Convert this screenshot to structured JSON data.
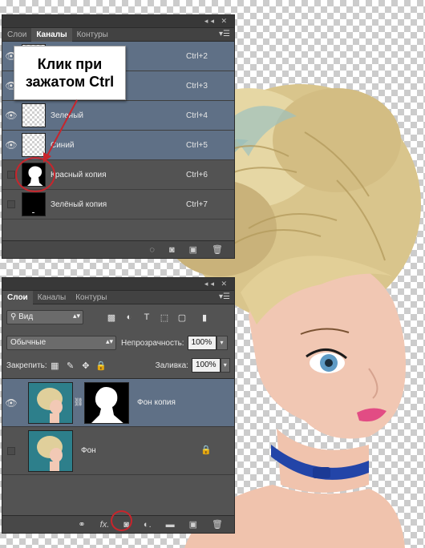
{
  "channels_panel": {
    "tabs": [
      "Слои",
      "Каналы",
      "Контуры"
    ],
    "active_tab": 1,
    "rows": [
      {
        "name": "",
        "shortcut": "Ctrl+2",
        "visible": true,
        "selected": true
      },
      {
        "name": "",
        "shortcut": "Ctrl+3",
        "visible": true,
        "selected": true
      },
      {
        "name": "Зеленый",
        "shortcut": "Ctrl+4",
        "visible": true,
        "selected": true
      },
      {
        "name": "Синий",
        "shortcut": "Ctrl+5",
        "visible": true,
        "selected": true
      },
      {
        "name": "Красный копия",
        "shortcut": "Ctrl+6",
        "visible": false,
        "selected": false
      },
      {
        "name": "Зелёный копия",
        "shortcut": "Ctrl+7",
        "visible": false,
        "selected": false
      }
    ]
  },
  "callout": {
    "text": "Клик при зажатом Ctrl"
  },
  "layers_panel": {
    "tabs": [
      "Слои",
      "Каналы",
      "Контуры"
    ],
    "active_tab": 0,
    "filter_label": "Вид",
    "blend_mode": "Обычные",
    "opacity_label": "Непрозрачность:",
    "opacity_value": "100%",
    "lock_label": "Закрепить:",
    "fill_label": "Заливка:",
    "fill_value": "100%",
    "layers": [
      {
        "name": "Фон копия",
        "visible": true,
        "selected": true,
        "has_mask": true
      },
      {
        "name": "Фон",
        "visible": false,
        "selected": false,
        "locked": true
      }
    ]
  },
  "colors": {
    "panel_bg": "#535353",
    "selected_row": "#5f7086",
    "highlight_ring": "#c8252c"
  }
}
